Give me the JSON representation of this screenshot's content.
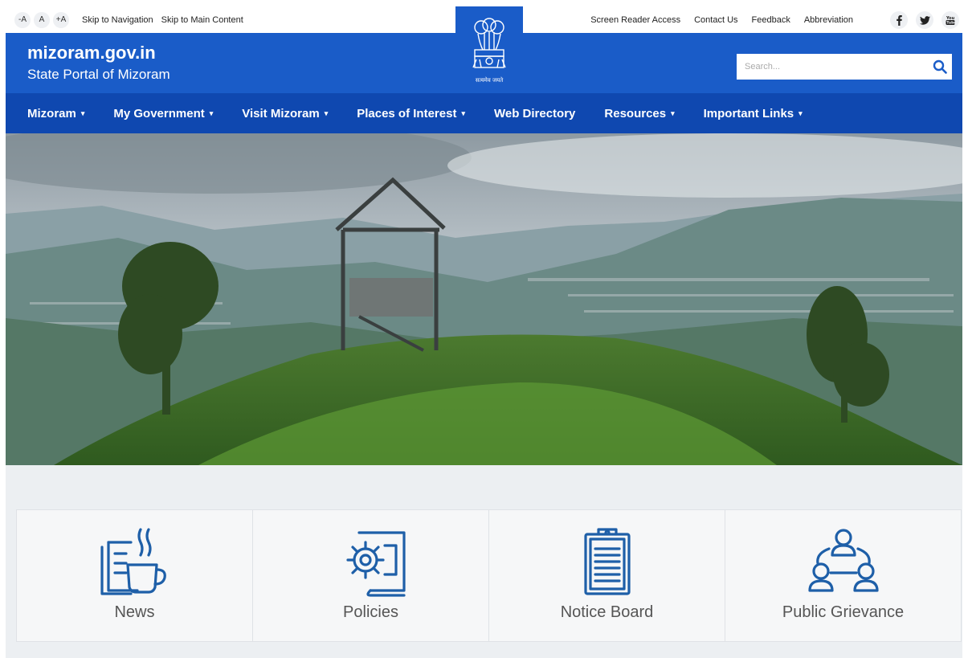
{
  "topbar": {
    "font_controls": [
      "-A",
      "A",
      "+A"
    ],
    "skip_navigation": "Skip to Navigation",
    "skip_main": "Skip to Main Content",
    "links": [
      "Screen Reader Access",
      "Contact Us",
      "Feedback",
      "Abbreviation"
    ],
    "social": [
      {
        "icon": "facebook-icon",
        "glyph": "f"
      },
      {
        "icon": "twitter-icon",
        "glyph": "t"
      },
      {
        "icon": "youtube-icon",
        "glyph": "You"
      }
    ]
  },
  "emblem": {
    "text": "सत्यमेव जयते",
    "icon": "national-emblem-icon"
  },
  "header": {
    "site_name": "mizoram.gov.in",
    "subtitle": "State Portal of Mizoram",
    "search_placeholder": "Search...",
    "search_icon": "search-icon"
  },
  "nav": {
    "items": [
      {
        "label": "Mizoram",
        "dropdown": true
      },
      {
        "label": "My Government",
        "dropdown": true
      },
      {
        "label": "Visit Mizoram",
        "dropdown": true
      },
      {
        "label": "Places of Interest",
        "dropdown": true
      },
      {
        "label": "Web Directory",
        "dropdown": false
      },
      {
        "label": "Resources",
        "dropdown": true
      },
      {
        "label": "Important Links",
        "dropdown": true
      }
    ]
  },
  "services": [
    {
      "label": "News",
      "icon": "news-coffee-icon"
    },
    {
      "label": "Policies",
      "icon": "policies-gear-book-icon"
    },
    {
      "label": "Notice Board",
      "icon": "clipboard-icon"
    },
    {
      "label": "Public Grievance",
      "icon": "people-network-icon"
    }
  ],
  "colors": {
    "header_blue": "#1a5cc8",
    "nav_blue": "#0f48b0",
    "icon_blue": "#1e5fa8"
  }
}
